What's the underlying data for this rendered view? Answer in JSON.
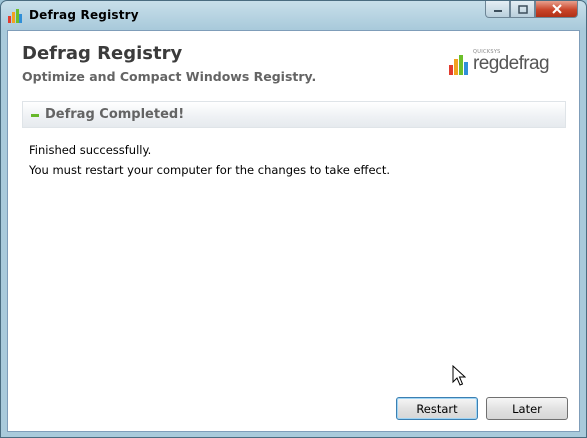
{
  "window": {
    "title": "Defrag Registry",
    "controls": {
      "minimize_icon": "minimize-icon",
      "maximize_icon": "maximize-icon",
      "close_icon": "close-icon"
    }
  },
  "header": {
    "heading": "Defrag Registry",
    "subheading": "Optimize and Compact Windows Registry.",
    "logo": {
      "small_text": "QUICKSYS",
      "word": "regdefrag"
    }
  },
  "section": {
    "title": "Defrag Completed!"
  },
  "messages": {
    "line1": "Finished successfully.",
    "line2": "You must restart your computer for the changes to take effect."
  },
  "buttons": {
    "restart_label": "Restart",
    "later_label": "Later"
  },
  "colors": {
    "accent_green": "#67b82a",
    "close_red": "#c9452a",
    "title_bar": "#a9cadb"
  }
}
